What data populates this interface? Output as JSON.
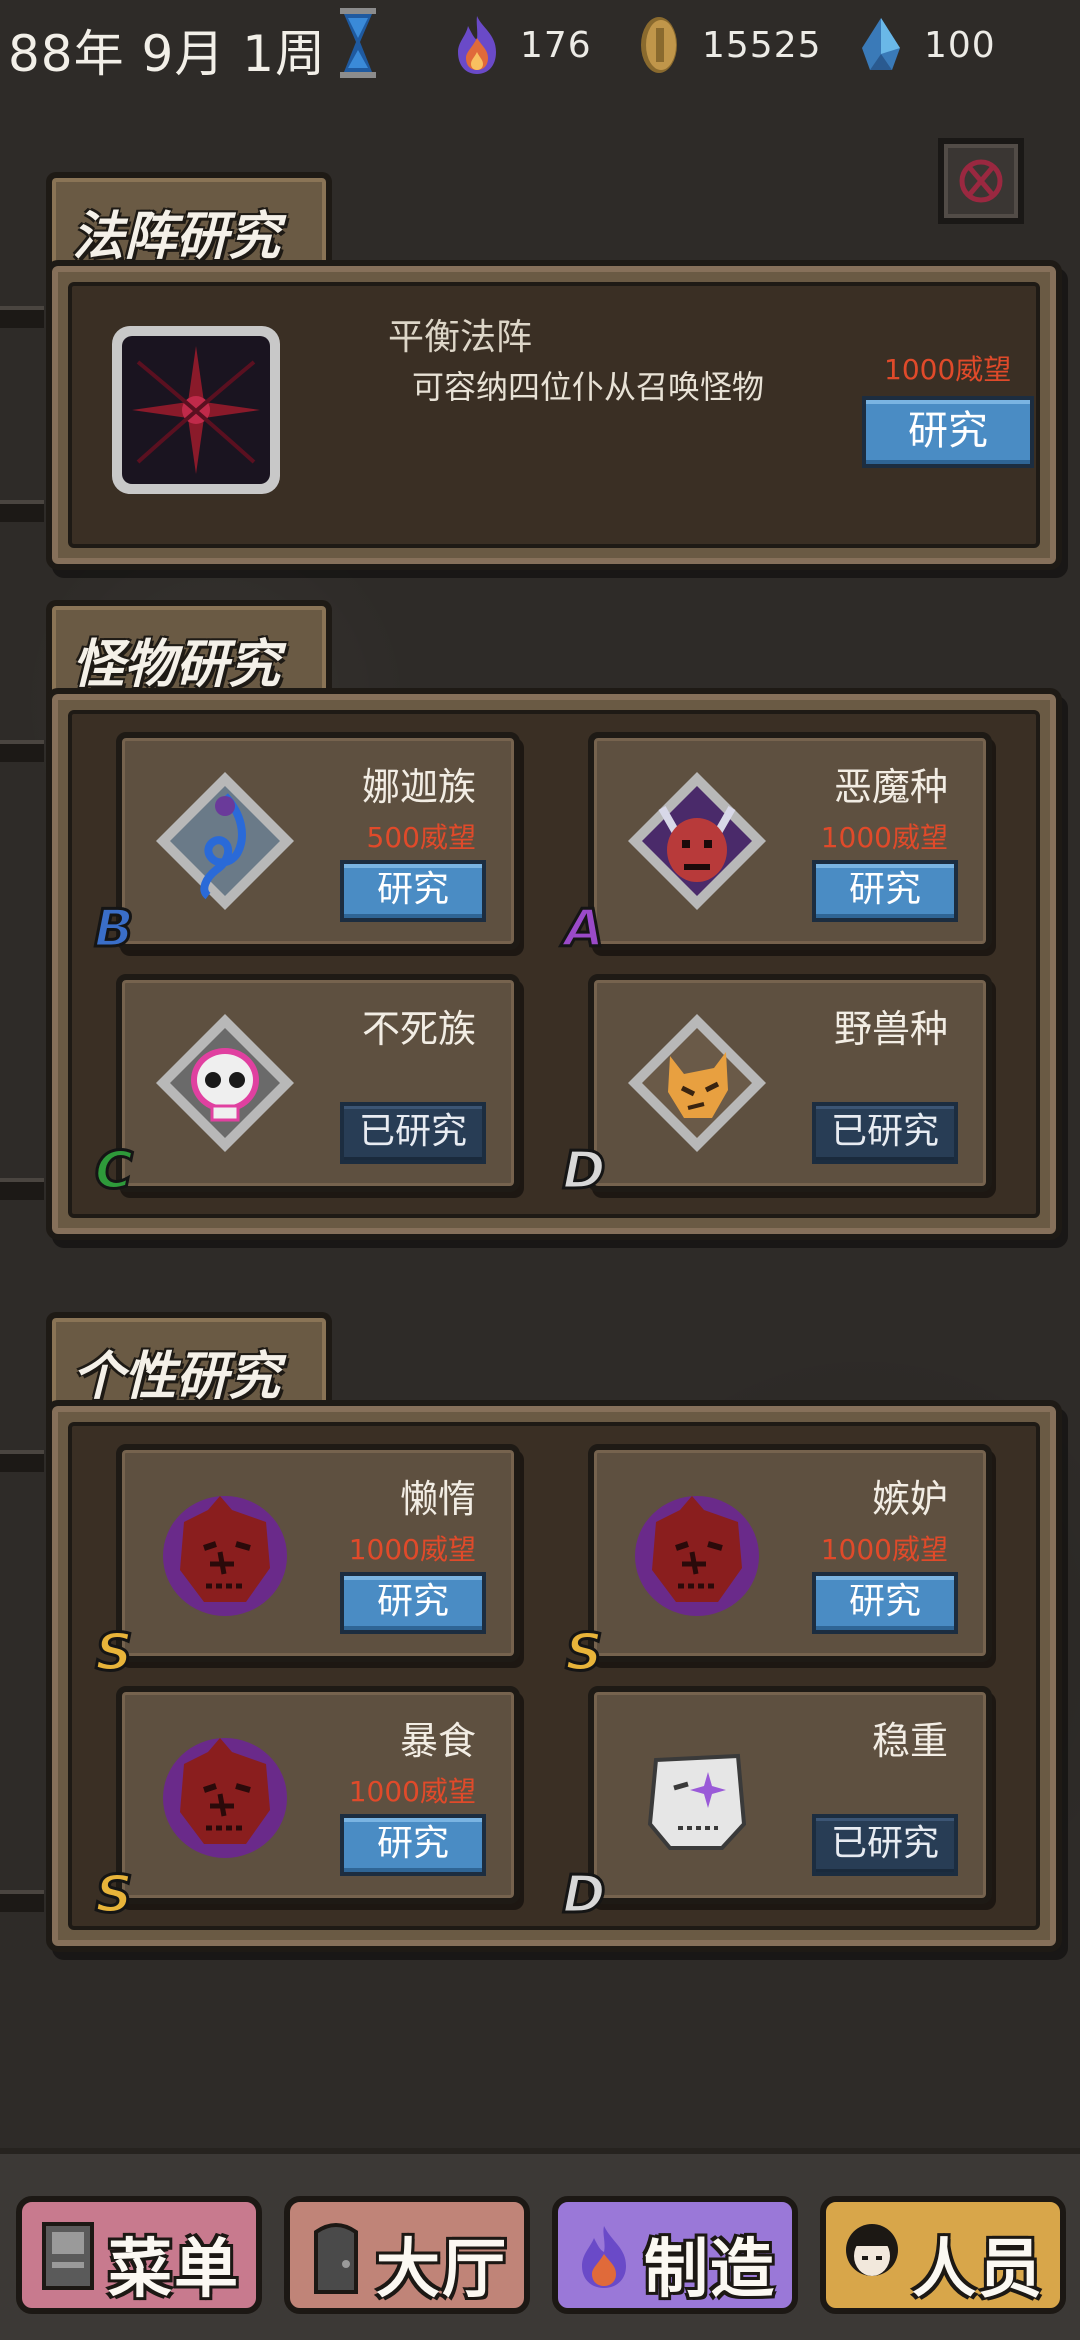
{
  "status": {
    "date": "88年 9月 1周",
    "fire": "176",
    "coins": "15525",
    "crystal": "100"
  },
  "formation": {
    "title": "法阵研究",
    "name": "平衡法阵",
    "desc": "可容纳四位仆从召唤怪物",
    "cost": "1000威望",
    "button": "研究"
  },
  "monster": {
    "title": "怪物研究",
    "cards": [
      {
        "name": "娜迦族",
        "cost": "500威望",
        "button": "研究",
        "grade": "B",
        "done": false
      },
      {
        "name": "恶魔种",
        "cost": "1000威望",
        "button": "研究",
        "grade": "A",
        "done": false
      },
      {
        "name": "不死族",
        "cost": "",
        "button": "已研究",
        "grade": "C",
        "done": true
      },
      {
        "name": "野兽种",
        "cost": "",
        "button": "已研究",
        "grade": "D",
        "done": true
      }
    ]
  },
  "personality": {
    "title": "个性研究",
    "cards": [
      {
        "name": "懒惰",
        "cost": "1000威望",
        "button": "研究",
        "grade": "S",
        "done": false
      },
      {
        "name": "嫉妒",
        "cost": "1000威望",
        "button": "研究",
        "grade": "S",
        "done": false
      },
      {
        "name": "暴食",
        "cost": "1000威望",
        "button": "研究",
        "grade": "S",
        "done": false
      },
      {
        "name": "稳重",
        "cost": "",
        "button": "已研究",
        "grade": "D",
        "done": true
      }
    ]
  },
  "nav": {
    "menu": "菜单",
    "hall": "大厅",
    "craft": "制造",
    "staff": "人员"
  },
  "colors": {
    "research_button": "#4a8cc4",
    "researched_button": "#283d55",
    "cost_text": "#e04a2a",
    "grade_S": "#e8b43a",
    "grade_A": "#9a4ac8",
    "grade_B": "#3a6ec8",
    "grade_C": "#2e9a3a",
    "grade_D": "#d8d8d8"
  }
}
